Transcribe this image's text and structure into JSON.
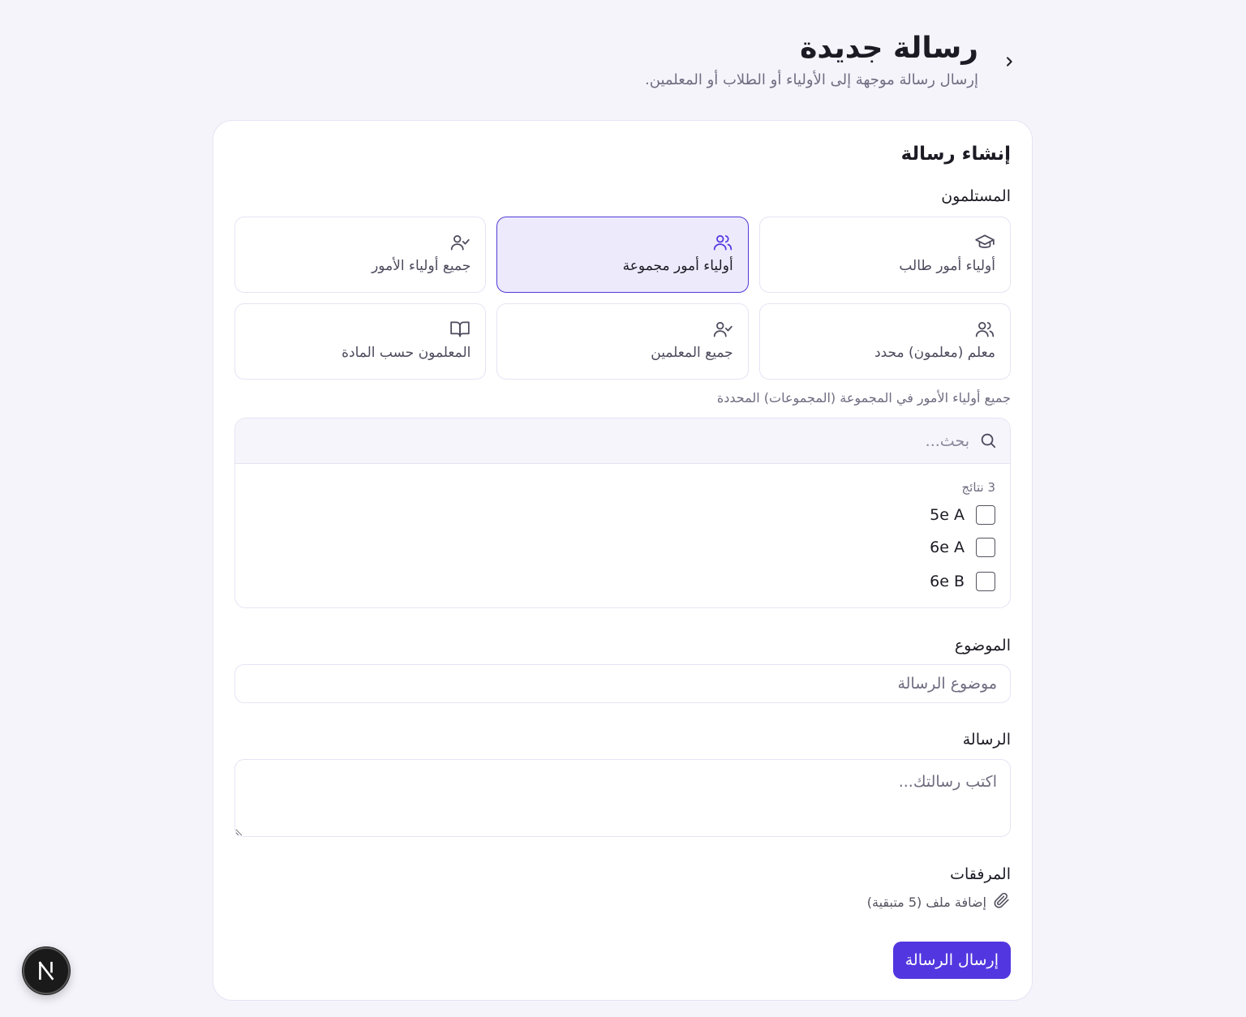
{
  "header": {
    "title": "رسالة جديدة",
    "subtitle": "إرسال رسالة موجهة إلى الأولياء أو الطلاب أو المعلمين."
  },
  "card": {
    "title": "إنشاء رسالة",
    "recipients_label": "المستلمون",
    "recipients": [
      {
        "label": "أولياء أمور طالب",
        "icon": "graduation-cap-icon",
        "selected": false
      },
      {
        "label": "أولياء أمور مجموعة",
        "icon": "users-icon",
        "selected": true
      },
      {
        "label": "جميع أولياء الأمور",
        "icon": "user-check-icon",
        "selected": false
      },
      {
        "label": "معلم (معلمون) محدد",
        "icon": "users-icon",
        "selected": false
      },
      {
        "label": "جميع المعلمين",
        "icon": "user-check-icon",
        "selected": false
      },
      {
        "label": "المعلمون حسب المادة",
        "icon": "book-open-icon",
        "selected": false
      }
    ],
    "helper_text": "جميع أولياء الأمور في المجموعة (المجموعات) المحددة",
    "picker": {
      "search_placeholder": "بحث...",
      "results_count": "3 نتائج",
      "options": [
        {
          "label": "5e A",
          "checked": false
        },
        {
          "label": "6e A",
          "checked": false
        },
        {
          "label": "6e B",
          "checked": false
        }
      ]
    },
    "subject": {
      "label": "الموضوع",
      "placeholder": "موضوع الرسالة",
      "value": ""
    },
    "message": {
      "label": "الرسالة",
      "placeholder": "اكتب رسالتك...",
      "value": ""
    },
    "attachments": {
      "label": "المرفقات",
      "add_label": "إضافة ملف (5 متبقية)"
    },
    "send_label": "إرسال الرسالة"
  },
  "colors": {
    "accent": "#5237e0",
    "selected_bg": "#edeafc",
    "page_bg": "#f5f4fb",
    "border": "#e6e3f3"
  },
  "badge": {
    "letter": "N"
  }
}
